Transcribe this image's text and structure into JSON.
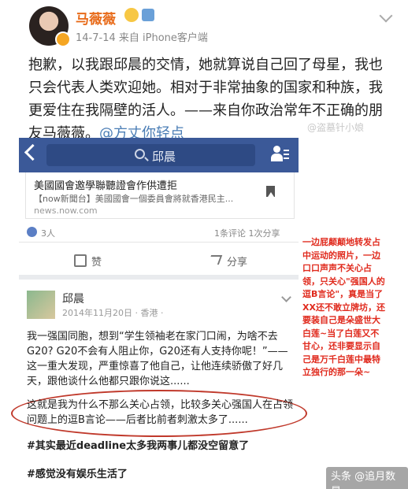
{
  "weibo": {
    "author": "马薇薇",
    "meta": "14-7-14  来自 iPhone客户端",
    "text_part1": "抱歉，以我跟邱晨的交情，她就算说自己回了母星，我也只会代表人类欢迎她。相对于非常抽象的国家和种族，我更爱住在我隔壁的活人。——来自你政治常年不正确的朋友马薇薇。",
    "mention": "@方丈你轻点",
    "watermark": "@盗墓针小娘"
  },
  "facebook": {
    "search_text": "邱晨",
    "link_card": {
      "title": "美國國會邀學聯聽證會作供遭拒",
      "desc": "【now新聞台】美國國會一個委員會將就香港民主...",
      "domain": "news.now.com"
    },
    "reactions_count": "3人",
    "stats": "1条评论  1次分享",
    "like_label": "赞",
    "share_label": "分享",
    "post": {
      "author": "邱晨",
      "date": "2014年11月20日 · 香港 · ",
      "body1": "我一强国同胞，想到“学生领袖老在家门口闹，为啥不去G20? G20不会有人阻止你，G20还有人支持你呢！”——这一重大发现，严重惊喜了他自己，让他连续骄傲了好几天，跟他谈什么他都只跟你说这......",
      "body2": "这就是我为什么不那么关心占领，比较多关心强国人在占领问题上的逗B言论——后者比前者刺激太多了......",
      "tag1": "#其实最近deadline太多我两事儿都没空留意了",
      "tag2": "#感觉没有娱乐生活了"
    }
  },
  "annotation": "一边屁颠颠地转发占中运动的照片，一边口口声声不关心占领，只关心\"强国人的逗B言论\"，真是当了XX还不敢立牌坊，还要装自己是朵盛世大白莲~当了白莲又不甘心，还非要显示自己是万千白莲中最特立独行的那一朵~",
  "footer_watermark": "头条 @追月数星",
  "colors": {
    "fb_blue": "#3b5998",
    "annotation_red": "#e02a1d",
    "name_orange": "#e86b1a"
  }
}
